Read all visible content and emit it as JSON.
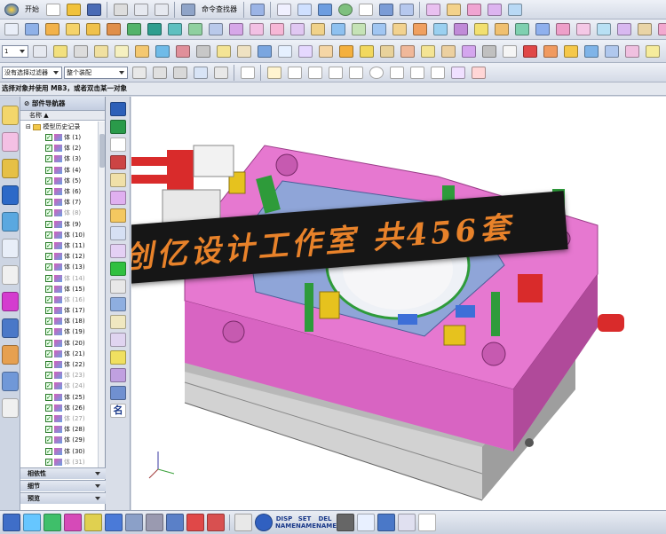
{
  "toolbar": {
    "start_label": "开始",
    "command_finder_label": "命令查找器"
  },
  "selection_bar": {
    "filter_label": "没有选择过滤器",
    "scope_label": "整个装配"
  },
  "status_text": "选择对象并使用 MB3，或者双击某一对象",
  "navigator": {
    "title": "部件导航器",
    "column_name": "名称",
    "root_label": "模型历史记录",
    "items": [
      {
        "label": "体 (1)",
        "dim": false
      },
      {
        "label": "体 (2)",
        "dim": false
      },
      {
        "label": "体 (3)",
        "dim": false
      },
      {
        "label": "体 (4)",
        "dim": false
      },
      {
        "label": "体 (5)",
        "dim": false
      },
      {
        "label": "体 (6)",
        "dim": false
      },
      {
        "label": "体 (7)",
        "dim": false
      },
      {
        "label": "体 (8)",
        "dim": true
      },
      {
        "label": "体 (9)",
        "dim": false
      },
      {
        "label": "体 (10)",
        "dim": false
      },
      {
        "label": "体 (11)",
        "dim": false
      },
      {
        "label": "体 (12)",
        "dim": false
      },
      {
        "label": "体 (13)",
        "dim": false
      },
      {
        "label": "体 (14)",
        "dim": true
      },
      {
        "label": "体 (15)",
        "dim": false
      },
      {
        "label": "体 (16)",
        "dim": true
      },
      {
        "label": "体 (17)",
        "dim": false
      },
      {
        "label": "体 (18)",
        "dim": false
      },
      {
        "label": "体 (19)",
        "dim": false
      },
      {
        "label": "体 (20)",
        "dim": false
      },
      {
        "label": "体 (21)",
        "dim": false
      },
      {
        "label": "体 (22)",
        "dim": false
      },
      {
        "label": "体 (23)",
        "dim": true
      },
      {
        "label": "体 (24)",
        "dim": true
      },
      {
        "label": "体 (25)",
        "dim": false
      },
      {
        "label": "体 (26)",
        "dim": false
      },
      {
        "label": "体 (27)",
        "dim": true
      },
      {
        "label": "体 (28)",
        "dim": false
      },
      {
        "label": "体 (29)",
        "dim": false
      },
      {
        "label": "体 (30)",
        "dim": false
      },
      {
        "label": "体 (31)",
        "dim": true
      }
    ],
    "panels": [
      "相依性",
      "细节",
      "预览"
    ]
  },
  "banner": {
    "text": "创亿设计工作室 共456套",
    "bg_color": "#161616",
    "text_color": "#e8822a"
  },
  "bottom_bar": {
    "disp_name": "DISP NAME",
    "set_name": "SET NAME",
    "del_name": "DEL NAME"
  },
  "colors": {
    "mold_pink": "#e678d0",
    "plate_gray": "#c9c9c9",
    "insert_green": "#2e9b3a",
    "insert_yellow": "#e6c21e",
    "insert_blue": "#3d6fd8",
    "accent_red": "#d92b2b"
  }
}
